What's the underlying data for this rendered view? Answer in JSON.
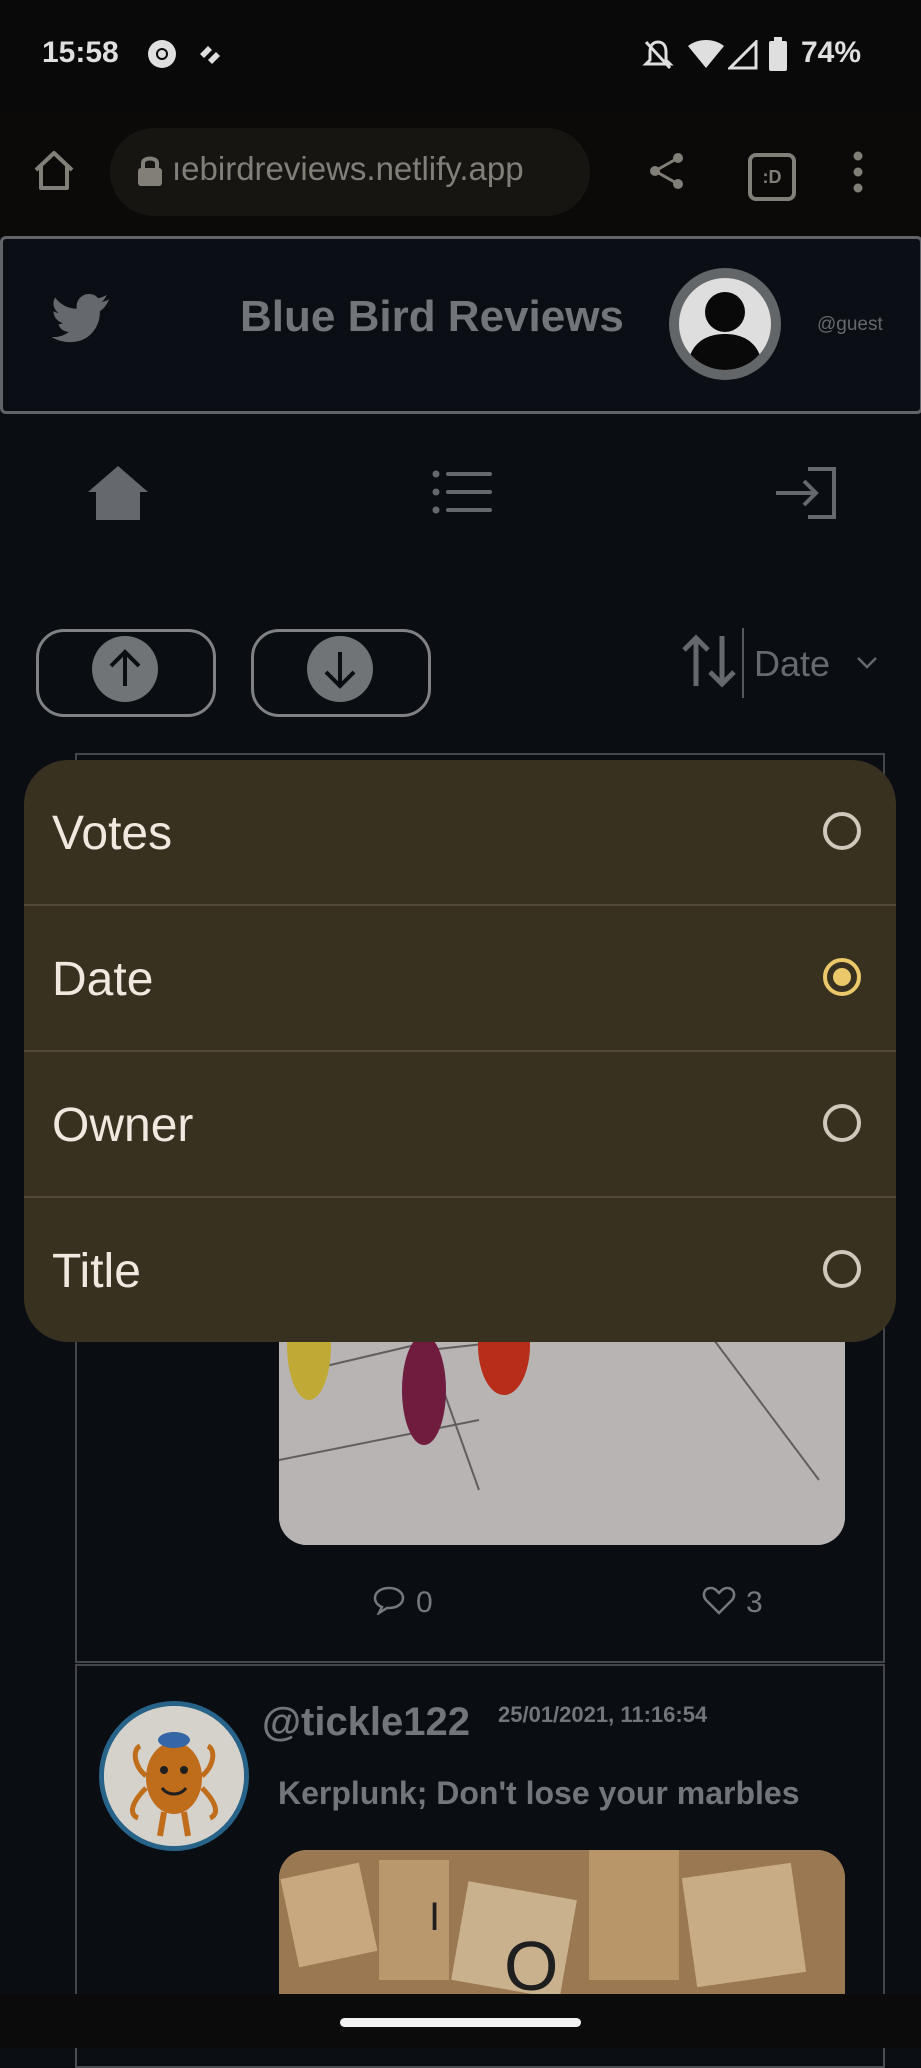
{
  "status_bar": {
    "time": "15:58",
    "battery": "74%"
  },
  "browser": {
    "url": "ıebirdreviews.netlify.app",
    "tab_count": ":D"
  },
  "header": {
    "title": "Blue Bird Reviews",
    "handle": "@guest"
  },
  "sort": {
    "selected": "Date"
  },
  "dropdown": {
    "options": [
      {
        "label": "Votes",
        "selected": false
      },
      {
        "label": "Date",
        "selected": true
      },
      {
        "label": "Owner",
        "selected": false
      },
      {
        "label": "Title",
        "selected": false
      }
    ]
  },
  "post1": {
    "comments": "0",
    "likes": "3"
  },
  "post2": {
    "username": "@tickle122",
    "datetime": "25/01/2021, 11:16:54",
    "title": "Kerplunk; Don't lose your marbles"
  },
  "colors": {
    "accent": "#ebc96b",
    "menu_bg": "#38311f"
  }
}
